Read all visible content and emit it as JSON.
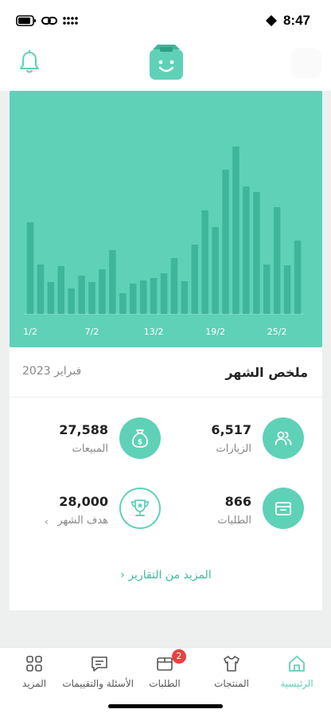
{
  "status_bar": {
    "time": "8:47"
  },
  "header": {
    "logo_icon": "smiley-box-icon",
    "bell_icon": "bell-icon"
  },
  "chart_data": {
    "type": "bar",
    "categories": [
      "1/2",
      "2/2",
      "3/2",
      "4/2",
      "5/2",
      "6/2",
      "7/2",
      "8/2",
      "9/2",
      "10/2",
      "11/2",
      "12/2",
      "13/2",
      "14/2",
      "15/2",
      "16/2",
      "17/2",
      "18/2",
      "19/2",
      "20/2",
      "21/2",
      "22/2",
      "23/2",
      "24/2",
      "25/2",
      "26/2",
      "27/2"
    ],
    "values": [
      115,
      62,
      40,
      60,
      32,
      48,
      40,
      56,
      80,
      26,
      38,
      42,
      45,
      51,
      70,
      41,
      87,
      130,
      109,
      181,
      210,
      160,
      153,
      62,
      134,
      61,
      92
    ],
    "x_tick_labels": [
      "1/2",
      "7/2",
      "13/2",
      "19/2",
      "25/2"
    ],
    "ylim": [
      0,
      230
    ],
    "bar_color": "#3fb59b",
    "background": "#5fd1b7",
    "grid": false
  },
  "summary": {
    "title": "ملخص الشهر",
    "date": "فبراير 2023",
    "stats": {
      "visits": {
        "value": "6,517",
        "label": "الزيارات",
        "icon": "users-icon"
      },
      "sales": {
        "value": "27,588",
        "label": "المبيعات",
        "icon": "money-bag-icon"
      },
      "orders": {
        "value": "866",
        "label": "الطلبات",
        "icon": "box-icon"
      },
      "goal": {
        "value": "28,000",
        "label": "هدف الشهر",
        "icon": "trophy-icon"
      }
    },
    "more_reports": "المزيد من التقارير"
  },
  "nav": {
    "items": [
      {
        "label": "الرئيسية",
        "icon": "home-icon",
        "active": true
      },
      {
        "label": "المنتجات",
        "icon": "shirt-icon",
        "active": false
      },
      {
        "label": "الطلبات",
        "icon": "orders-box-icon",
        "active": false,
        "badge": "2"
      },
      {
        "label": "الأسئلة والتقييمات",
        "icon": "chat-icon",
        "active": false
      },
      {
        "label": "المزيد",
        "icon": "grid-icon",
        "active": false
      }
    ]
  },
  "colors": {
    "accent": "#5fd1b7",
    "accent_dark": "#3fb59b",
    "badge": "#e8423f"
  }
}
